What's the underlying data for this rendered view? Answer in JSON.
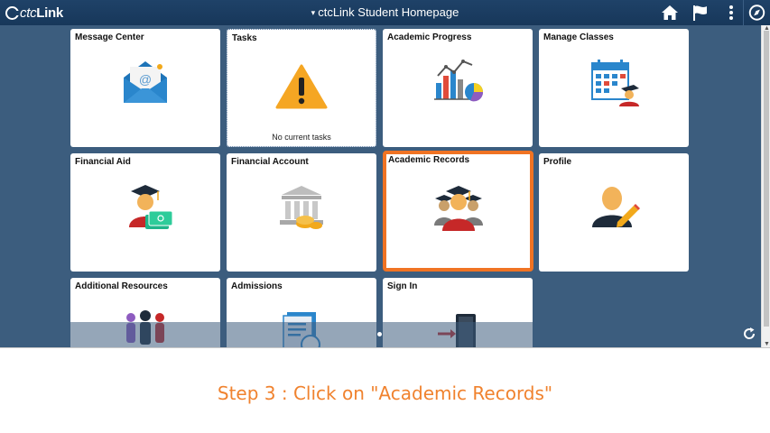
{
  "header": {
    "logo_text_prefix": "ctc",
    "logo_text_suffix": "Link",
    "title": "ctcLink Student Homepage",
    "title_caret": "▾"
  },
  "tiles": [
    {
      "title": "Message Center",
      "icon": "envelope-icon"
    },
    {
      "title": "Tasks",
      "icon": "warning-icon",
      "note": "No current tasks"
    },
    {
      "title": "Academic Progress",
      "icon": "charts-icon"
    },
    {
      "title": "Manage Classes",
      "icon": "calendar-student-icon"
    },
    {
      "title": "Financial Aid",
      "icon": "graduate-money-icon"
    },
    {
      "title": "Financial Account",
      "icon": "bank-coins-icon"
    },
    {
      "title": "Academic Records",
      "icon": "graduates-group-icon",
      "selected": true
    },
    {
      "title": "Profile",
      "icon": "profile-pencil-icon"
    },
    {
      "title": "Additional Resources",
      "icon": "people-gear-icon"
    },
    {
      "title": "Admissions",
      "icon": "document-student-icon"
    },
    {
      "title": "Sign In",
      "icon": "door-arrow-icon"
    }
  ],
  "caption": {
    "text": "Step 3 : Click on \"Academic Records\""
  },
  "colors": {
    "header_bg": "#1c3f64",
    "page_bg": "#3c5d7e",
    "highlight": "#f07323",
    "caption_text": "#f0822e"
  }
}
